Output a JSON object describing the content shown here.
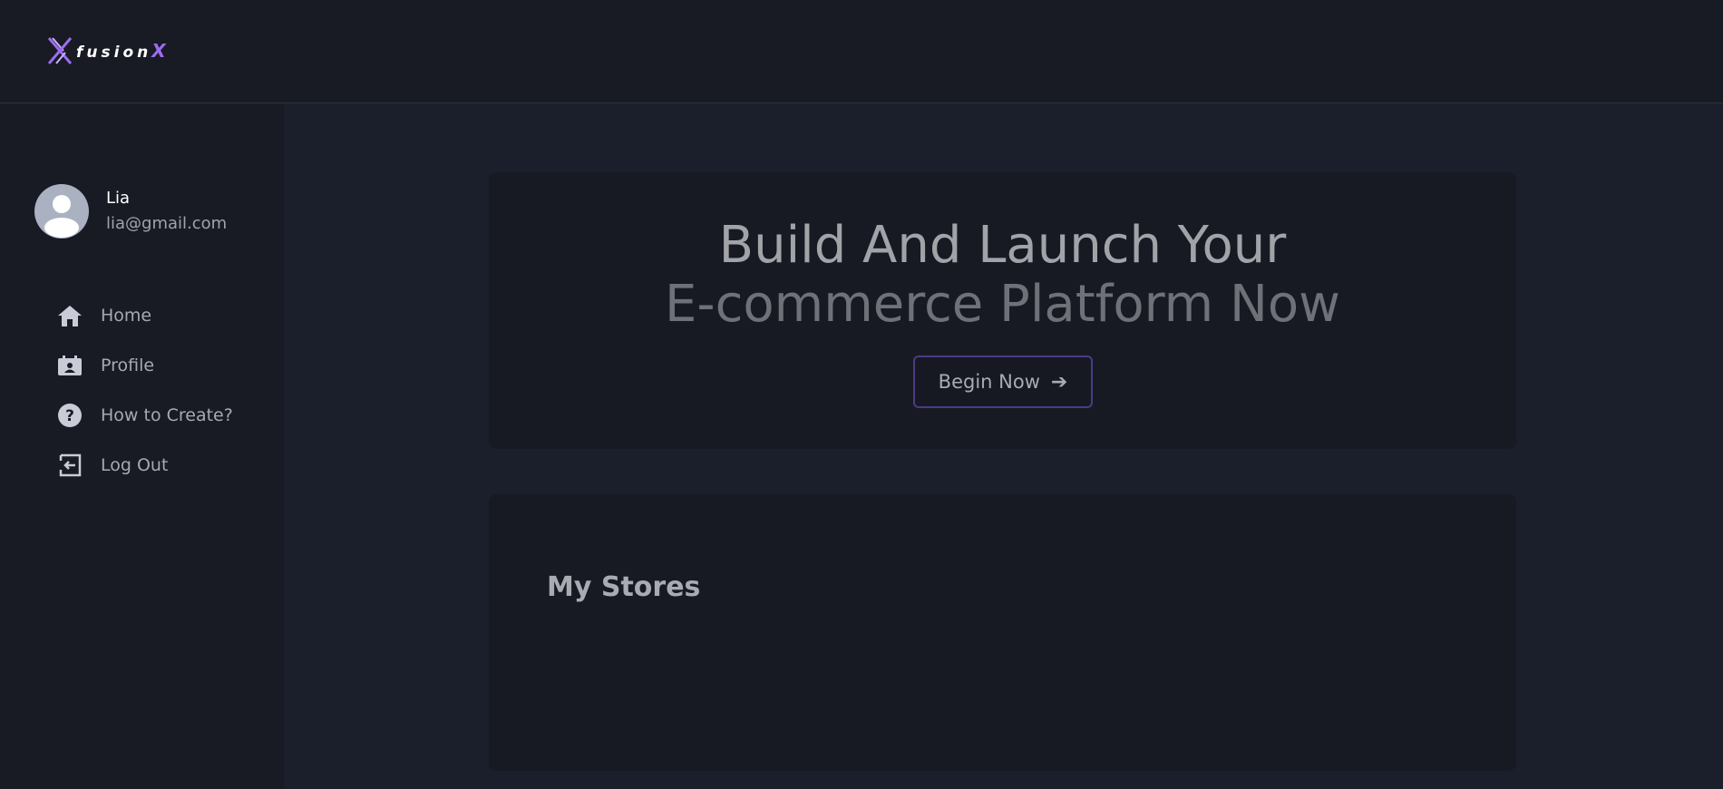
{
  "header": {
    "logo_text": "fusion",
    "logo_x": "X"
  },
  "user": {
    "name": "Lia",
    "email": "lia@gmail.com"
  },
  "nav": {
    "items": [
      {
        "label": "Home",
        "icon": "home-icon"
      },
      {
        "label": "Profile",
        "icon": "profile-card-icon"
      },
      {
        "label": "How to Create?",
        "icon": "question-icon"
      },
      {
        "label": "Log Out",
        "icon": "logout-icon"
      }
    ]
  },
  "hero": {
    "title_line1": "Build And Launch Your",
    "title_line2": "E-commerce Platform Now",
    "button_label": "Begin Now",
    "button_arrow": "➔"
  },
  "stores": {
    "title": "My Stores"
  },
  "colors": {
    "accent": "#9b6cf0",
    "button_border": "#4b3a86",
    "background": "#1b1f2b",
    "panel": "#181a24"
  }
}
